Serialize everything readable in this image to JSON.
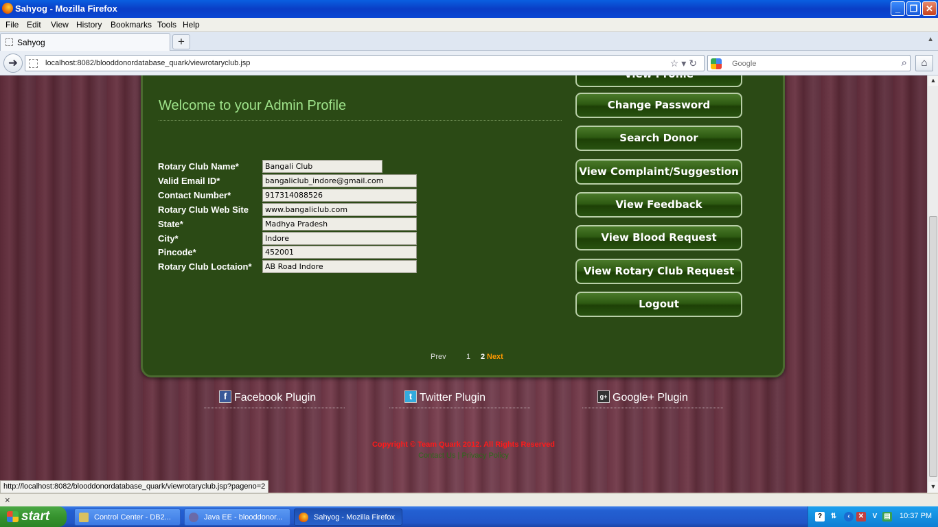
{
  "window": {
    "title": "Sahyog - Mozilla Firefox",
    "minimize": "_",
    "maximize": "❐",
    "close": "✕"
  },
  "menu": {
    "file": "File",
    "edit": "Edit",
    "view": "View",
    "history": "History",
    "bookmarks": "Bookmarks",
    "tools": "Tools",
    "help": "Help"
  },
  "tabs": [
    {
      "label": "Sahyog"
    }
  ],
  "newtab": "+",
  "address": {
    "url": "localhost:8082/blooddonordatabase_quark/viewrotaryclub.jsp"
  },
  "search": {
    "placeholder": "Google"
  },
  "page": {
    "welcome": "Welcome to your Admin Profile",
    "form": [
      {
        "label": "Rotary Club Name*",
        "value": "Bangali Club"
      },
      {
        "label": "Valid Email ID*",
        "value": "bangaliclub_indore@gmail.com"
      },
      {
        "label": "Contact Number*",
        "value": "917314088526"
      },
      {
        "label": "Rotary Club Web Site",
        "value": "www.bangaliclub.com"
      },
      {
        "label": "State*",
        "value": "Madhya Pradesh"
      },
      {
        "label": "City*",
        "value": "Indore"
      },
      {
        "label": "Pincode*",
        "value": "452001"
      },
      {
        "label": "Rotary Club Loctaion*",
        "value": "AB Road Indore"
      }
    ],
    "menu_buttons": [
      "View Profile",
      "Change Password",
      "Search Donor",
      "View Complaint/Suggestion",
      "View Feedback",
      "View Blood Request",
      "View Rotary Club Request",
      "Logout"
    ],
    "pagination": {
      "prev": "Prev",
      "page1": "1",
      "page2": "2",
      "next": "Next"
    },
    "social": [
      {
        "icon": "f",
        "label": "Facebook Plugin",
        "color": "#3b5998"
      },
      {
        "icon": "t",
        "label": "Twitter Plugin",
        "color": "#33aadd"
      },
      {
        "icon": "g+",
        "label": "Google+ Plugin",
        "color": "#333333"
      }
    ],
    "copyright": "Copyright © Team Quark 2012. All Rights Reserved",
    "footer_links": {
      "contact": "Contact Us",
      "separator": "|",
      "privacy": "Privacy Policy"
    }
  },
  "status_url": "http://localhost:8082/blooddonordatabase_quark/viewrotaryclub.jsp?pageno=2",
  "addon_close": "×",
  "taskbar": {
    "start": "start",
    "tasks": [
      {
        "label": "Control Center - DB2...",
        "active": false
      },
      {
        "label": "Java EE - blooddonor...",
        "active": false
      },
      {
        "label": "Sahyog - Mozilla Firefox",
        "active": true
      }
    ],
    "clock": "10:37 PM"
  },
  "colors": {
    "panel": "#2b4a15",
    "welcome": "#9ee28a",
    "copyright": "#ff1a1a",
    "next": "#ff9900"
  }
}
